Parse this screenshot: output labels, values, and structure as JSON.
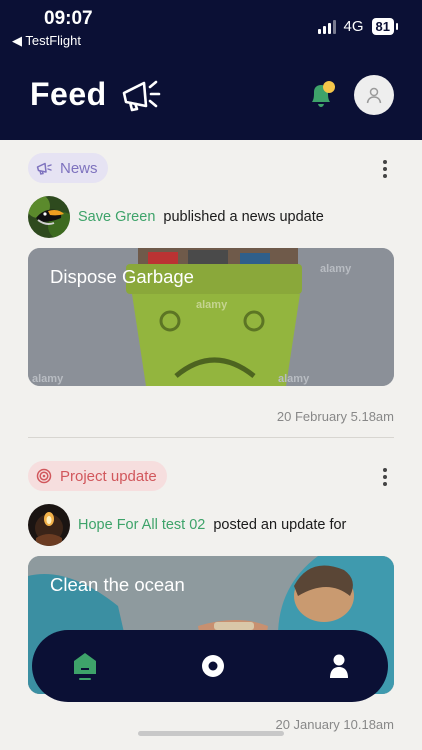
{
  "status": {
    "time": "09:07",
    "back_label": "◀ TestFlight",
    "network": "4G",
    "battery": "81"
  },
  "header": {
    "title": "Feed"
  },
  "posts": [
    {
      "tag": "News",
      "author": "Save Green",
      "action": "published a news update",
      "title": "Dispose Garbage",
      "date": "20 February 5.18am",
      "watermark": "alamy"
    },
    {
      "tag": "Project update",
      "author": "Hope For All test 02",
      "action": "posted an update for",
      "title": "Clean the ocean",
      "date": "20 January 10.18am"
    }
  ],
  "colors": {
    "navy": "#0b1035",
    "accent_green": "#3ea36a",
    "news_purple": "#7e72be",
    "project_red": "#d1575c",
    "notification_dot": "#f5c64a"
  },
  "nav": {
    "items": [
      "home-icon",
      "discover-icon",
      "profile-icon"
    ],
    "active": "home-icon"
  }
}
